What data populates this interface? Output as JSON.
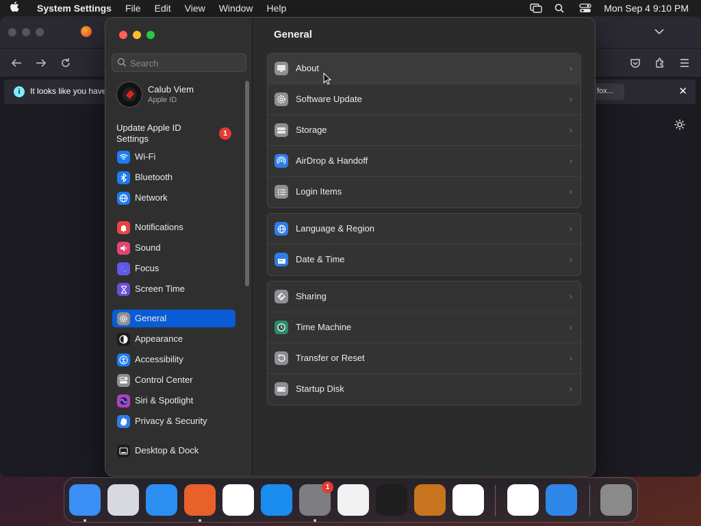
{
  "menubar": {
    "app_name": "System Settings",
    "menus": [
      "File",
      "Edit",
      "View",
      "Window",
      "Help"
    ],
    "clock": "Mon Sep 4  9:10 PM"
  },
  "browser": {
    "notice_text": "It looks like you have",
    "notice_button": "fox..."
  },
  "sidebar": {
    "search_placeholder": "Search",
    "profile": {
      "name": "Calub Viem",
      "subtitle": "Apple ID"
    },
    "update": {
      "label": "Update Apple ID Settings",
      "badge": "1"
    },
    "items": [
      {
        "label": "Wi-Fi",
        "icon": "wifi-icon",
        "color": "#1f7cf0"
      },
      {
        "label": "Bluetooth",
        "icon": "bluetooth-icon",
        "color": "#1f7cf0"
      },
      {
        "label": "Network",
        "icon": "globe-icon",
        "color": "#1f7cf0"
      },
      {
        "label": "Notifications",
        "icon": "bell-icon",
        "color": "#e64545"
      },
      {
        "label": "Sound",
        "icon": "speaker-icon",
        "color": "#e64570"
      },
      {
        "label": "Focus",
        "icon": "moon-icon",
        "color": "#5e5ce6"
      },
      {
        "label": "Screen Time",
        "icon": "hourglass-icon",
        "color": "#6a4fd6"
      },
      {
        "label": "General",
        "icon": "gear-icon",
        "color": "#8e8e93"
      },
      {
        "label": "Appearance",
        "icon": "appearance-icon",
        "color": "#1c1c1e"
      },
      {
        "label": "Accessibility",
        "icon": "accessibility-icon",
        "color": "#1f7cf0"
      },
      {
        "label": "Control Center",
        "icon": "toggles-icon",
        "color": "#8e8e93"
      },
      {
        "label": "Siri & Spotlight",
        "icon": "siri-icon",
        "color": "#b040c0"
      },
      {
        "label": "Privacy & Security",
        "icon": "hand-icon",
        "color": "#2f7de6"
      },
      {
        "label": "Desktop & Dock",
        "icon": "dock-icon",
        "color": "#1c1c1e"
      }
    ],
    "active": "General"
  },
  "main": {
    "title": "General",
    "groups": [
      [
        {
          "label": "About",
          "icon": "monitor-icon",
          "color": "#8e8e93"
        },
        {
          "label": "Software Update",
          "icon": "gear-badge-icon",
          "color": "#8e8e93"
        },
        {
          "label": "Storage",
          "icon": "drive-icon",
          "color": "#8e8e93"
        },
        {
          "label": "AirDrop & Handoff",
          "icon": "airdrop-icon",
          "color": "#2f7de6"
        },
        {
          "label": "Login Items",
          "icon": "list-icon",
          "color": "#8e8e93"
        }
      ],
      [
        {
          "label": "Language & Region",
          "icon": "globe-icon",
          "color": "#2f7de6"
        },
        {
          "label": "Date & Time",
          "icon": "calendar-icon",
          "color": "#2f7de6"
        }
      ],
      [
        {
          "label": "Sharing",
          "icon": "sharing-icon",
          "color": "#8e8e93"
        },
        {
          "label": "Time Machine",
          "icon": "clock-icon",
          "color": "#2f8a6a"
        },
        {
          "label": "Transfer or Reset",
          "icon": "reset-icon",
          "color": "#8e8e93"
        },
        {
          "label": "Startup Disk",
          "icon": "disk-icon",
          "color": "#8e8e93"
        }
      ]
    ],
    "chevron": "›"
  },
  "dock": {
    "apps": [
      {
        "name": "finder-app-icon",
        "color": "#3a8ef5"
      },
      {
        "name": "launchpad-app-icon",
        "color": "#d8d8e0"
      },
      {
        "name": "safari-app-icon",
        "color": "#2b8ff2"
      },
      {
        "name": "firefox-app-icon",
        "color": "#e8602a"
      },
      {
        "name": "chrome-app-icon",
        "color": "#ffffff"
      },
      {
        "name": "app-store-app-icon",
        "color": "#1a8cf0"
      },
      {
        "name": "system-settings-app-icon",
        "color": "#7d7d82",
        "badge": "1"
      },
      {
        "name": "textedit-app-icon",
        "color": "#f2f2f2"
      },
      {
        "name": "terminal-app-icon",
        "color": "#1e1e1e"
      },
      {
        "name": "garageband-app-icon",
        "color": "#c8741e"
      },
      {
        "name": "vscode-app-icon",
        "color": "#ffffff"
      },
      {
        "name": "visual-studio-app-icon",
        "color": "#ffffff"
      },
      {
        "name": "weather-app-icon",
        "color": "#2e86e6"
      },
      {
        "name": "trash-app-icon",
        "color": "#8a8a8a"
      }
    ]
  }
}
